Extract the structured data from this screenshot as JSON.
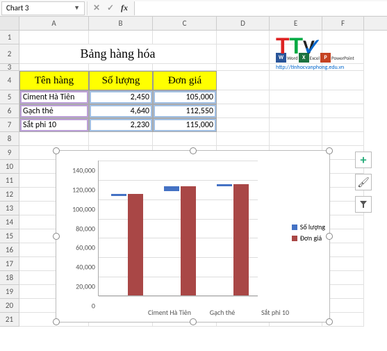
{
  "namebox": "Chart 3",
  "fx_label": "fx",
  "cancel_label": "✕",
  "confirm_label": "✓",
  "columns": [
    "A",
    "B",
    "C",
    "D",
    "E",
    "F"
  ],
  "title": "Bảng hàng hóa",
  "headers": {
    "name": "Tên hàng",
    "qty": "Số lượng",
    "price": "Đơn giá"
  },
  "rows": [
    {
      "name": "Ciment Hà Tiên",
      "qty": "2,450",
      "price": "105,000"
    },
    {
      "name": "Gạch thẻ",
      "qty": "4,640",
      "price": "112,550"
    },
    {
      "name": "Sắt phi 10",
      "qty": "2,230",
      "price": "115,000"
    }
  ],
  "logo": {
    "apps": [
      {
        "c": "#2a5599",
        "t": "W",
        "l": "Word"
      },
      {
        "c": "#1b7240",
        "t": "X",
        "l": "Excel"
      },
      {
        "c": "#c54322",
        "t": "P",
        "l": "PowerPoint"
      }
    ],
    "url": "http://tinhocvanphong.edu.vn"
  },
  "legend": {
    "s1": "Số lượng",
    "s2": "Đơn giá"
  },
  "side": {
    "plus": "+",
    "brush": "🖌",
    "filter": "▾"
  },
  "chart_data": {
    "type": "bar",
    "categories": [
      "Ciment Hà Tiên",
      "Gạch thẻ",
      "Sắt phi 10"
    ],
    "series": [
      {
        "name": "Số lượng",
        "values": [
          2450,
          4640,
          2230
        ],
        "color": "#4472c4"
      },
      {
        "name": "Đơn giá",
        "values": [
          105000,
          112550,
          115000
        ],
        "color": "#a94746"
      }
    ],
    "ylim": [
      0,
      140000
    ],
    "ystep": 20000,
    "xlabel": "",
    "ylabel": "",
    "title": ""
  }
}
